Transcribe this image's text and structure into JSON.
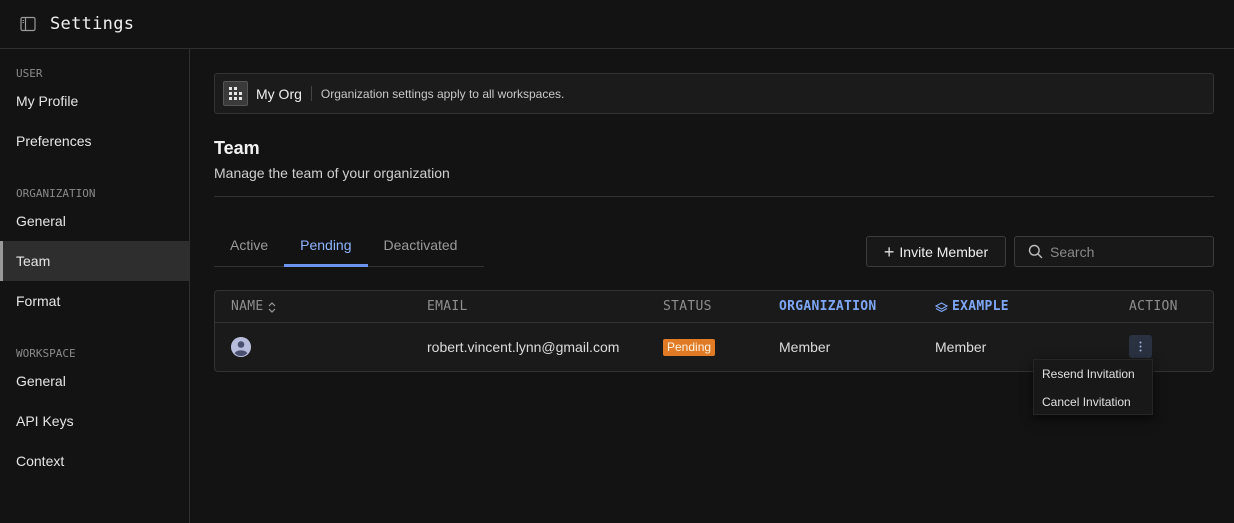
{
  "app": {
    "title": "Settings"
  },
  "sidebar": {
    "groups": [
      {
        "label": "USER",
        "items": [
          {
            "label": "My Profile"
          },
          {
            "label": "Preferences"
          }
        ]
      },
      {
        "label": "ORGANIZATION",
        "items": [
          {
            "label": "General"
          },
          {
            "label": "Team"
          },
          {
            "label": "Format"
          }
        ]
      },
      {
        "label": "WORKSPACE",
        "items": [
          {
            "label": "General"
          },
          {
            "label": "API Keys"
          },
          {
            "label": "Context"
          }
        ]
      }
    ],
    "active": "Team"
  },
  "org": {
    "name": "My Org",
    "note": "Organization settings apply to all workspaces."
  },
  "section": {
    "title": "Team",
    "subtitle": "Manage the team of your organization"
  },
  "tabs": [
    {
      "label": "Active"
    },
    {
      "label": "Pending"
    },
    {
      "label": "Deactivated"
    }
  ],
  "active_tab": "Pending",
  "toolbar": {
    "invite_label": "Invite Member",
    "search_placeholder": "Search"
  },
  "table": {
    "columns": [
      "NAME",
      "EMAIL",
      "STATUS",
      "ORGANIZATION",
      "EXAMPLE",
      "ACTION"
    ],
    "rows": [
      {
        "name": "",
        "email": "robert.vincent.lynn@gmail.com",
        "status": "Pending",
        "organization": "Member",
        "example": "Member"
      }
    ]
  },
  "action_menu": {
    "items": [
      "Resend Invitation",
      "Cancel Invitation"
    ]
  },
  "colors": {
    "accent": "#6d95f0",
    "pending_badge": "#e07a25",
    "background": "#131313"
  },
  "icons": [
    "sidebar-panel-icon",
    "org-grid-icon",
    "plus-icon",
    "search-icon",
    "sort-icon",
    "layers-icon",
    "user-avatar-icon",
    "more-vertical-icon"
  ]
}
